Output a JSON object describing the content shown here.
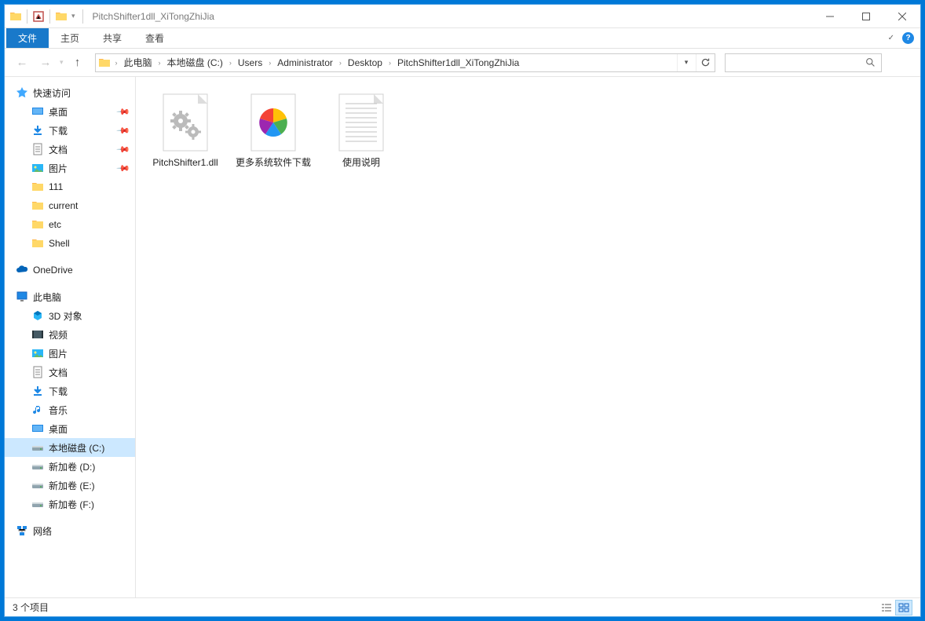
{
  "window": {
    "title": "PitchShifter1dll_XiTongZhiJia"
  },
  "ribbon": {
    "file": "文件",
    "tabs": [
      "主页",
      "共享",
      "查看"
    ]
  },
  "breadcrumbs": [
    "此电脑",
    "本地磁盘 (C:)",
    "Users",
    "Administrator",
    "Desktop",
    "PitchShifter1dll_XiTongZhiJia"
  ],
  "search": {
    "placeholder": ""
  },
  "sidebar": {
    "quick_access": "快速访问",
    "quick_items": [
      {
        "label": "桌面",
        "icon": "desktop",
        "pinned": true
      },
      {
        "label": "下载",
        "icon": "download",
        "pinned": true
      },
      {
        "label": "文档",
        "icon": "doc",
        "pinned": true
      },
      {
        "label": "图片",
        "icon": "pictures",
        "pinned": true
      },
      {
        "label": "111",
        "icon": "folder",
        "pinned": false
      },
      {
        "label": "current",
        "icon": "folder",
        "pinned": false
      },
      {
        "label": "etc",
        "icon": "folder",
        "pinned": false
      },
      {
        "label": "Shell",
        "icon": "folder",
        "pinned": false
      }
    ],
    "onedrive": "OneDrive",
    "thispc": "此电脑",
    "pc_items": [
      {
        "label": "3D 对象",
        "icon": "3d"
      },
      {
        "label": "视频",
        "icon": "video"
      },
      {
        "label": "图片",
        "icon": "pictures"
      },
      {
        "label": "文档",
        "icon": "doc"
      },
      {
        "label": "下载",
        "icon": "download"
      },
      {
        "label": "音乐",
        "icon": "music"
      },
      {
        "label": "桌面",
        "icon": "desktop"
      },
      {
        "label": "本地磁盘 (C:)",
        "icon": "drive",
        "selected": true
      },
      {
        "label": "新加卷 (D:)",
        "icon": "drive"
      },
      {
        "label": "新加卷 (E:)",
        "icon": "drive"
      },
      {
        "label": "新加卷 (F:)",
        "icon": "drive"
      }
    ],
    "network": "网络"
  },
  "files": [
    {
      "name": "PitchShifter1.dll",
      "type": "dll"
    },
    {
      "name": "更多系统软件下载",
      "type": "app"
    },
    {
      "name": "使用说明",
      "type": "txt"
    }
  ],
  "status": {
    "text": "3 个项目"
  }
}
